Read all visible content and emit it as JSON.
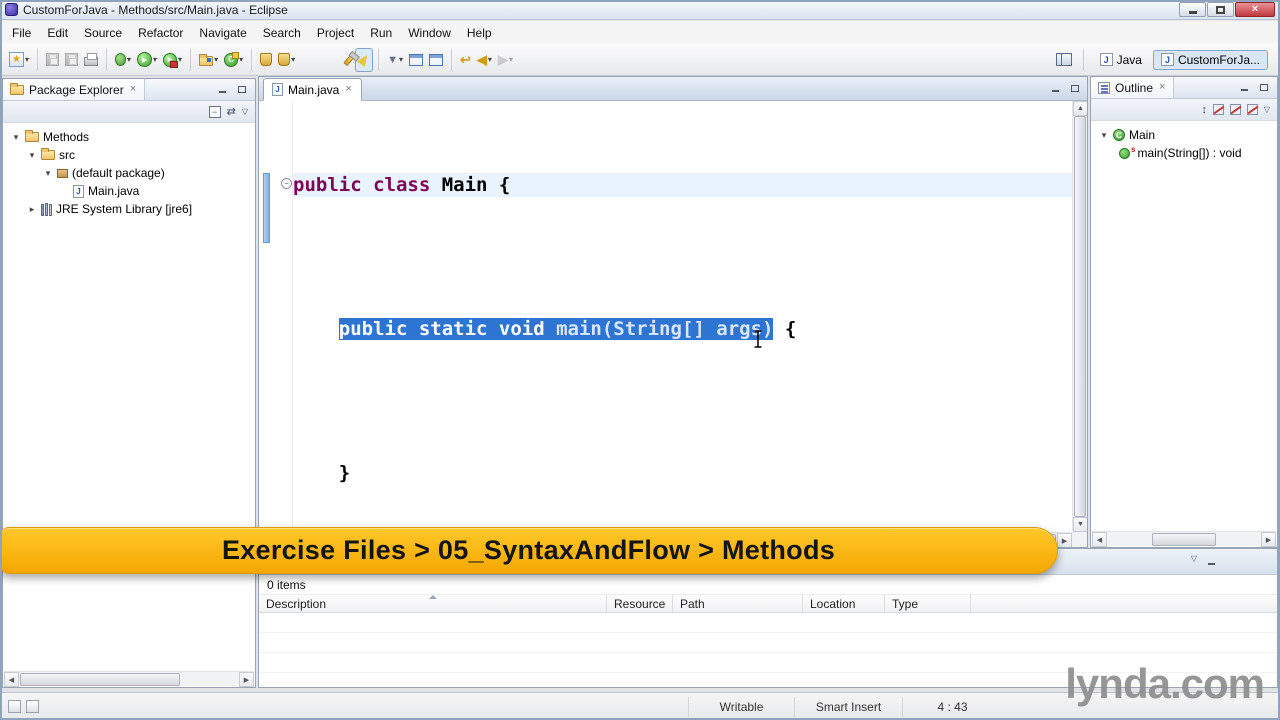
{
  "window": {
    "title": "CustomForJava - Methods/src/Main.java - Eclipse"
  },
  "menu": {
    "items": [
      "File",
      "Edit",
      "Source",
      "Refactor",
      "Navigate",
      "Search",
      "Project",
      "Run",
      "Window",
      "Help"
    ]
  },
  "perspectives": {
    "java": "Java",
    "active": "CustomForJa..."
  },
  "package_explorer": {
    "title": "Package Explorer",
    "items": [
      "Methods",
      "src",
      "(default package)",
      "Main.java",
      "JRE System Library [jre6]"
    ]
  },
  "editor": {
    "tab": "Main.java",
    "code": {
      "l1_kw": "public class",
      "l1_plain": " Main {",
      "l3_indent": "    ",
      "l3_sel_kw": "public static void",
      "l3_sel_plain": " main(String[] args)",
      "l3_after": " {",
      "l5": "    }",
      "l7": "}"
    }
  },
  "outline": {
    "title": "Outline",
    "class_name": "Main",
    "method": "main(String[]) : void",
    "static_decorator": "s"
  },
  "problems": {
    "count": "0 items",
    "columns": [
      "Description",
      "Resource",
      "Path",
      "Location",
      "Type"
    ]
  },
  "status": {
    "writable": "Writable",
    "insert_mode": "Smart Insert",
    "position": "4 : 43"
  },
  "banner": {
    "text": "Exercise Files > 05_SyntaxAndFlow > Methods"
  },
  "watermark": {
    "text": "lynda.com"
  },
  "colors": {
    "selection": "#2E74D2",
    "keyword": "#7F0055",
    "banner_gold": "#F9B60E",
    "line_highlight": "#E9F3FD"
  },
  "icons": {
    "close": "×",
    "dropdown": "▾",
    "twisty_open": "▾",
    "twisty_closed": "▸",
    "play": "▶",
    "up": "▲",
    "down": "▼",
    "left": "◀",
    "right": "▶",
    "star": "★",
    "java_letter": "J",
    "class_letter": "C",
    "minus": "−",
    "link": "⇄",
    "menu_down": "▽",
    "sort": "↕",
    "undo": "↩"
  }
}
